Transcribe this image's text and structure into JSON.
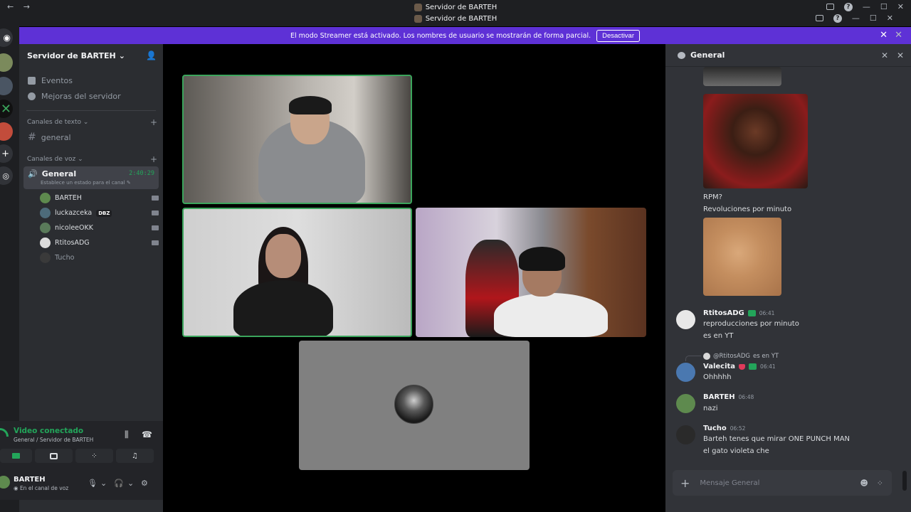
{
  "titlebar": {
    "title_1": "Servidor de BARTEH",
    "title_2": "Servidor de BARTEH",
    "back": "←",
    "forward": "→",
    "help": "?",
    "minimize": "—",
    "maximize": "☐",
    "close": "✕"
  },
  "banner": {
    "text": "El modo Streamer está activado. Los nombres de usuario se mostrarán de forma parcial.",
    "button": "Desactivar",
    "close": "✕"
  },
  "server": {
    "name": "Servidor de BARTEH",
    "events": "Eventos",
    "boosts": "Mejoras del servidor",
    "text_category": "Canales de texto",
    "voice_category": "Canales de voz",
    "text_channel": "general",
    "voice_channel": "General",
    "voice_timer": "2:40:29",
    "voice_status": "Establece un estado para el canal",
    "voice_users": [
      {
        "name": "BARTEH",
        "color": "#5e8a4e",
        "camera": true
      },
      {
        "name": "luckazceka",
        "color": "#4d6b7a",
        "camera": true,
        "badge": "DBZ"
      },
      {
        "name": "nicoleeOKK",
        "color": "#5a7a5a",
        "camera": true
      },
      {
        "name": "RtitosADG",
        "color": "#dcdcdc",
        "camera": true
      },
      {
        "name": "Tucho",
        "color": "#3a3a3a",
        "camera": false
      }
    ]
  },
  "voice_panel": {
    "status": "Video conectado",
    "location": "General / Servidor de BARTEH"
  },
  "user_panel": {
    "name": "BARTEH",
    "status": "En el canal de voz"
  },
  "chat": {
    "channel": "General",
    "plain_lines": {
      "rpm": "RPM?",
      "rpm_answer": "Revoluciones por minuto"
    },
    "messages": [
      {
        "author": "RtitosADG",
        "time": "06:41",
        "lines": [
          "reproducciones por minuto",
          "es en YT"
        ],
        "avatar_color": "#e8e8e8"
      },
      {
        "author": "Valecita",
        "time": "06:41",
        "reply_to": "@RtitosADG",
        "reply_text": "es en YT",
        "lines": [
          "Ohhhhh"
        ],
        "avatar_color": "#4a78b0"
      },
      {
        "author": "BARTEH",
        "time": "06:48",
        "lines": [
          "nazi"
        ],
        "avatar_color": "#5e8a4e"
      },
      {
        "author": "Tucho",
        "time": "06:52",
        "lines": [
          "Barteh tenes que mirar ONE PUNCH MAN",
          "el gato violeta che"
        ],
        "avatar_color": "#2a2a2a"
      }
    ],
    "input_placeholder": "Mensaje General"
  },
  "colors": {
    "accent_green": "#23a55a",
    "banner": "#5e31d6",
    "sidebar": "#2b2d31",
    "chat_bg": "#313338"
  }
}
